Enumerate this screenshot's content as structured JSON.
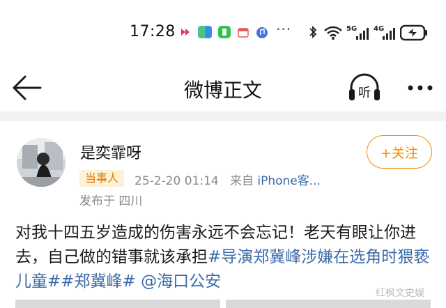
{
  "status_bar": {
    "time": "17:28",
    "more_dots": "···",
    "network_a": "5G",
    "network_b": "4G",
    "icons": [
      "app-icon",
      "maps-icon",
      "green-app-icon",
      "calendar-icon",
      "music-icon",
      "bluetooth-icon",
      "wifi-icon",
      "signal-icon",
      "battery-charging-icon"
    ]
  },
  "nav": {
    "title": "微博正文",
    "listen_label": "听"
  },
  "post": {
    "username": "是奕霏呀",
    "follow_label": "+关注",
    "role_badge": "当事人",
    "timestamp": "25-2-20 01:14",
    "source_prefix": "来自",
    "source": "iPhone客...",
    "location": "发布于 四川",
    "body_plain": "对我十四五岁造成的伤害永远不会忘记！老天有眼让你进去，自己做的错事就该承担",
    "tag1": "#导演郑冀峰涉嫌在选角时猥亵儿童#",
    "tag2": "#郑冀峰#",
    "mention": "@海口公安"
  },
  "watermark": "红枫文史娱",
  "colors": {
    "accent_orange": "#f08f00",
    "link_blue": "#3b6aa8",
    "meta_gray": "#8a8a8a"
  }
}
